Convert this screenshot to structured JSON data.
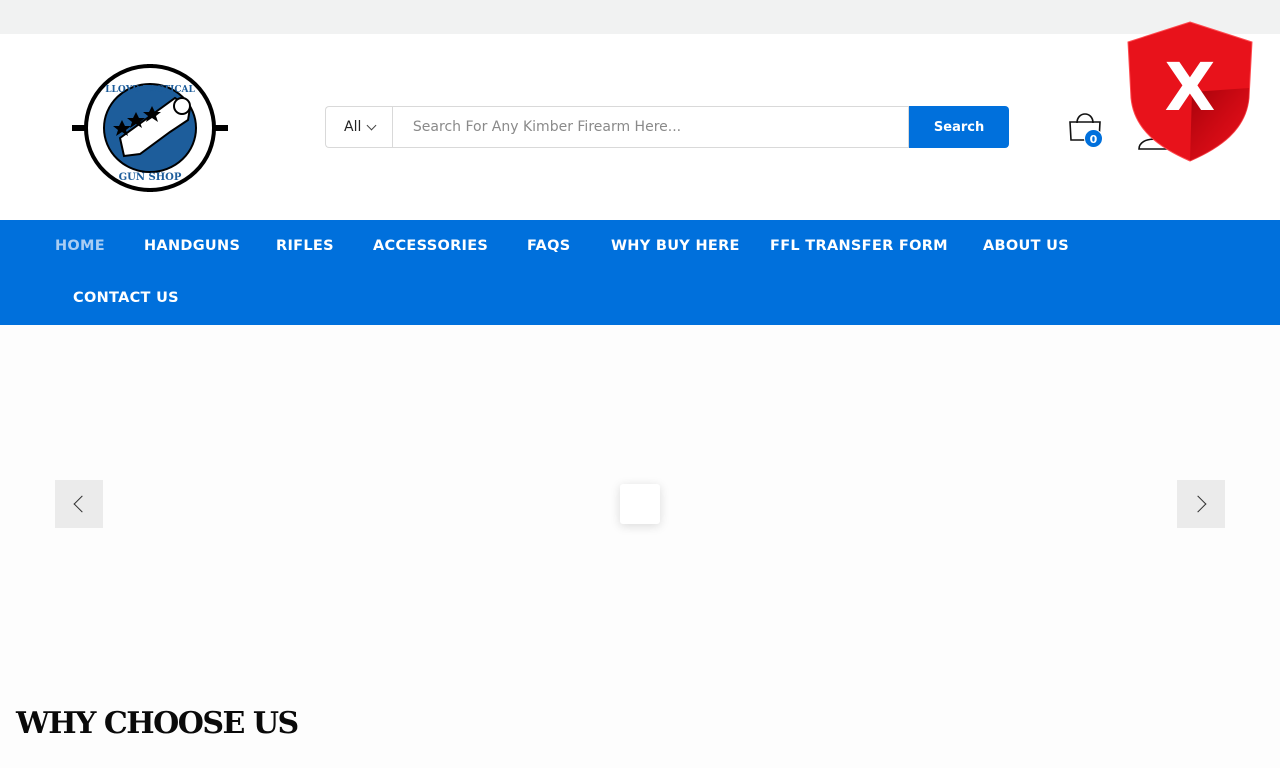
{
  "header": {
    "logo": {
      "text_top": "LLOYD TACTICAL",
      "text_bottom": "GUN SHOP"
    },
    "search": {
      "category": "All",
      "placeholder": "Search For Any Kimber Firearm Here...",
      "button_label": "Search"
    },
    "cart": {
      "count": "0"
    }
  },
  "nav": {
    "items": [
      {
        "label": "HOME",
        "active": true
      },
      {
        "label": "HANDGUNS"
      },
      {
        "label": "RIFLES"
      },
      {
        "label": "ACCESSORIES"
      },
      {
        "label": "FAQS"
      },
      {
        "label": "WHY BUY HERE"
      },
      {
        "label": "FFL TRANSFER FORM"
      },
      {
        "label": "ABOUT US"
      },
      {
        "label": "CONTACT US"
      }
    ]
  },
  "overlay": {
    "shield_letter": "X"
  },
  "sections": {
    "why_title": "WHY CHOOSE US"
  },
  "colors": {
    "brand": "#0070dc",
    "shield": "#e8121b"
  }
}
